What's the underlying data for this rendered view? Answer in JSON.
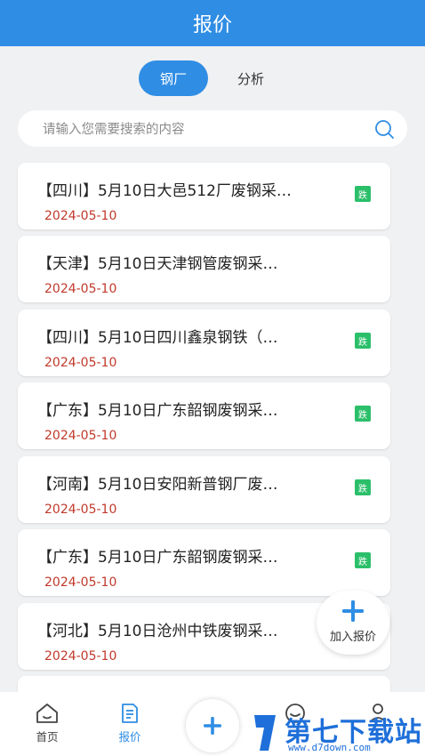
{
  "header": {
    "title": "报价"
  },
  "tabs": [
    {
      "label": "钢厂",
      "active": true
    },
    {
      "label": "分析",
      "active": false
    }
  ],
  "search": {
    "placeholder": "请输入您需要搜索的内容",
    "icon": "search-icon"
  },
  "items": [
    {
      "title": "【四川】5月10日大邑512厂废钢采…",
      "date": "2024-05-10",
      "badge": "跌"
    },
    {
      "title": "【天津】5月10日天津钢管废钢采…",
      "date": "2024-05-10",
      "badge": ""
    },
    {
      "title": "【四川】5月10日四川鑫泉钢铁（…",
      "date": "2024-05-10",
      "badge": "跌"
    },
    {
      "title": "【广东】5月10日广东韶钢废钢采…",
      "date": "2024-05-10",
      "badge": "跌"
    },
    {
      "title": "【河南】5月10日安阳新普钢厂废…",
      "date": "2024-05-10",
      "badge": "跌"
    },
    {
      "title": "【广东】5月10日广东韶钢废钢采…",
      "date": "2024-05-10",
      "badge": "跌"
    },
    {
      "title": "【河北】5月10日沧州中铁废钢采…",
      "date": "2024-05-10",
      "badge": ""
    }
  ],
  "partial_item": {
    "title": ""
  },
  "fab": {
    "label": "加入报价",
    "icon": "plus-icon"
  },
  "bottom_nav": [
    {
      "label": "首页",
      "icon": "home-icon",
      "active": false
    },
    {
      "label": "报价",
      "icon": "quote-doc-icon",
      "active": true
    },
    {
      "label": "",
      "icon": "plus-icon",
      "active": false
    },
    {
      "label": "",
      "icon": "chat-icon",
      "active": false
    },
    {
      "label": "",
      "icon": "user-icon",
      "active": false
    }
  ],
  "watermark": {
    "text": "第七下载站",
    "url": "www.d7down.com"
  },
  "colors": {
    "primary": "#2f8de4",
    "date": "#c0392b",
    "badge": "#2bbf6a"
  }
}
